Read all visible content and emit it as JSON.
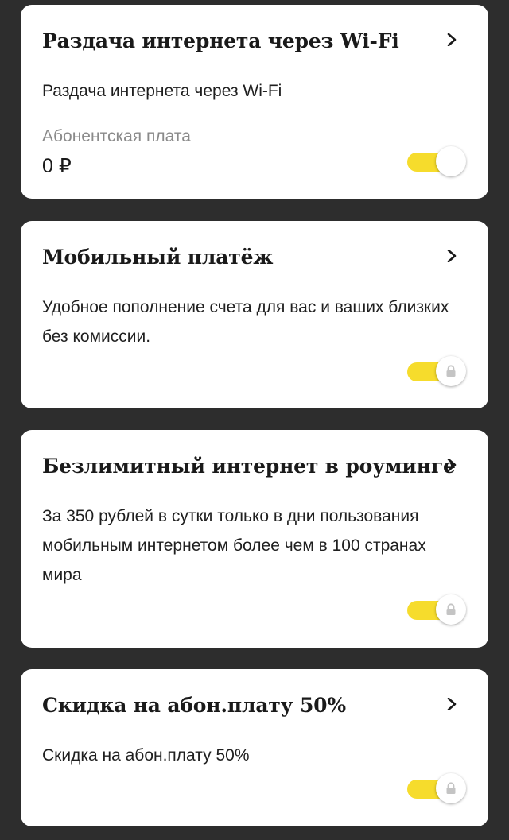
{
  "cards": [
    {
      "title": "Раздача интернета через Wi-Fi",
      "description": "Раздача интернета через Wi-Fi",
      "fee_label": "Абонентская плата",
      "fee_value": "0 ₽",
      "toggle_on": true,
      "locked": false
    },
    {
      "title": "Мобильный платёж",
      "description": "Удобное пополнение счета для вас и ваших близких без комиссии.",
      "toggle_on": true,
      "locked": true
    },
    {
      "title": "Безлимитный интернет в роуминге",
      "description": "За 350 рублей в сутки только в дни пользования мобильным интернетом более чем в 100 странах мира",
      "toggle_on": true,
      "locked": true
    },
    {
      "title": "Скидка на абон.плату 50%",
      "description": "Скидка на абон.плату 50%",
      "toggle_on": true,
      "locked": true
    }
  ],
  "icons": {
    "chevron": "chevron-right-icon",
    "lock": "lock-icon"
  },
  "colors": {
    "background": "#2d2d2d",
    "card": "#ffffff",
    "toggle_track": "#f6dc2c",
    "secondary_text": "#8a8a8a"
  }
}
